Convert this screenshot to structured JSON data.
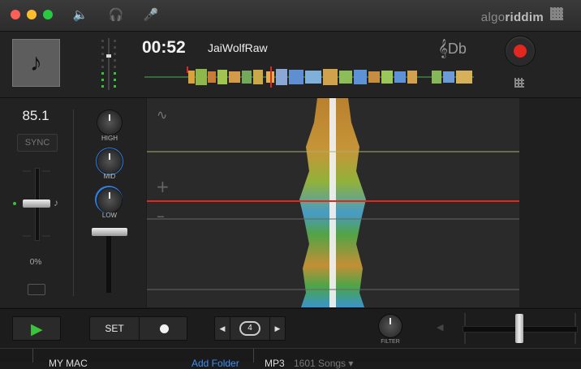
{
  "window": {
    "brand_prefix": "algo",
    "brand_suffix": "riddim",
    "icons": [
      "speaker-icon",
      "headphones-icon",
      "microphone-icon"
    ]
  },
  "deck": {
    "time": "00:52",
    "track_name": "JaiWolfRaw",
    "key": "Db",
    "record_color": "#e3261f"
  },
  "controls": {
    "bpm": "85.1",
    "sync_label": "SYNC",
    "pitch_percent": "0%",
    "eq_labels": [
      "HIGH",
      "MID",
      "LOW"
    ]
  },
  "transport": {
    "set_label": "SET",
    "loop_value": "4",
    "filter_label": "FILTER"
  },
  "library": {
    "source": "MY MAC",
    "add_folder": "Add Folder",
    "format": "MP3",
    "count": "1601 Songs"
  },
  "colors": {
    "accent_green": "#3bc33b",
    "accent_blue": "#3d8ff0",
    "playhead": "#e3261f"
  }
}
